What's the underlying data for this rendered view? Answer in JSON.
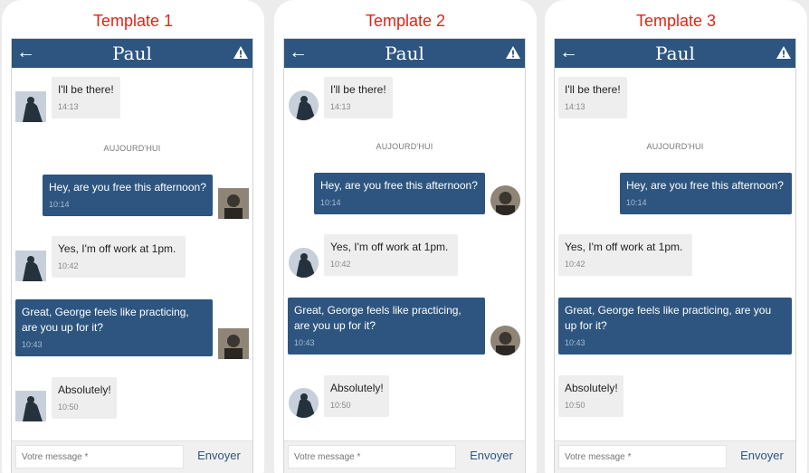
{
  "templates": [
    {
      "title": "Template 1",
      "header": {
        "contact": "Paul"
      },
      "messages": [
        {
          "text": "I'll be there!",
          "time": "14:13"
        },
        {
          "text": "Hey, are you free this afternoon?",
          "time": "10:14"
        },
        {
          "text": "Yes, I'm off work at 1pm.",
          "time": "10:42"
        },
        {
          "text": "Great, George feels like practicing, are you up for it?",
          "time": "10:43"
        },
        {
          "text": "Absolutely!",
          "time": "10:50"
        }
      ],
      "date_divider": "AUJOURD'HUI",
      "composer": {
        "placeholder": "Votre message *",
        "send": "Envoyer"
      }
    },
    {
      "title": "Template 2",
      "header": {
        "contact": "Paul"
      },
      "messages": [
        {
          "text": "I'll be there!",
          "time": "14:13"
        },
        {
          "text": "Hey, are you free this afternoon?",
          "time": "10:14"
        },
        {
          "text": "Yes, I'm off work at 1pm.",
          "time": "10:42"
        },
        {
          "text": "Great, George feels like practicing, are you up for it?",
          "time": "10:43"
        },
        {
          "text": "Absolutely!",
          "time": "10:50"
        }
      ],
      "date_divider": "AUJOURD'HUI",
      "composer": {
        "placeholder": "Votre message *",
        "send": "Envoyer"
      }
    },
    {
      "title": "Template 3",
      "header": {
        "contact": "Paul"
      },
      "messages": [
        {
          "text": "I'll be there!",
          "time": "14:13"
        },
        {
          "text": "Hey, are you free this afternoon?",
          "time": "10:14"
        },
        {
          "text": "Yes, I'm off work at 1pm.",
          "time": "10:42"
        },
        {
          "text": "Great, George feels like practicing, are you up for it?",
          "time": "10:43"
        },
        {
          "text": "Absolutely!",
          "time": "10:50"
        }
      ],
      "date_divider": "AUJOURD'HUI",
      "composer": {
        "placeholder": "Votre message *",
        "send": "Envoyer"
      }
    }
  ],
  "icons": {
    "back": "arrow-left-icon",
    "alert": "warning-triangle-icon"
  },
  "colors": {
    "title_red": "#e2231a",
    "brand_blue": "#2d5580",
    "incoming_bg": "#eeeeee"
  }
}
